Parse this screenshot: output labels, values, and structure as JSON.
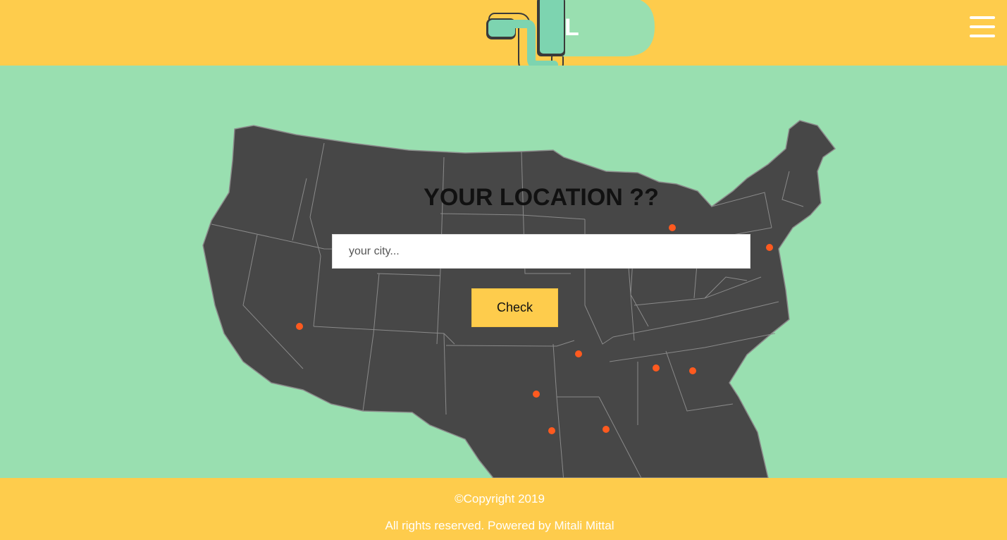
{
  "header": {
    "logo_letter": "L",
    "menu_icon": "hamburger-menu-icon"
  },
  "main": {
    "title": "YOUR LOCATION ??",
    "search": {
      "value": "",
      "placeholder": "your city..."
    },
    "check_label": "Check",
    "map": {
      "land_color": "#474747",
      "border_color": "#8a8a8a",
      "marker_color": "#ff5a1f"
    }
  },
  "footer": {
    "copyright": "©Copyright 2019",
    "rights": "All rights reserved. Powered by Mitali Mittal"
  },
  "colors": {
    "header": "#fecc4c",
    "background": "#99dfb0",
    "accent": "#7dd4b0"
  }
}
